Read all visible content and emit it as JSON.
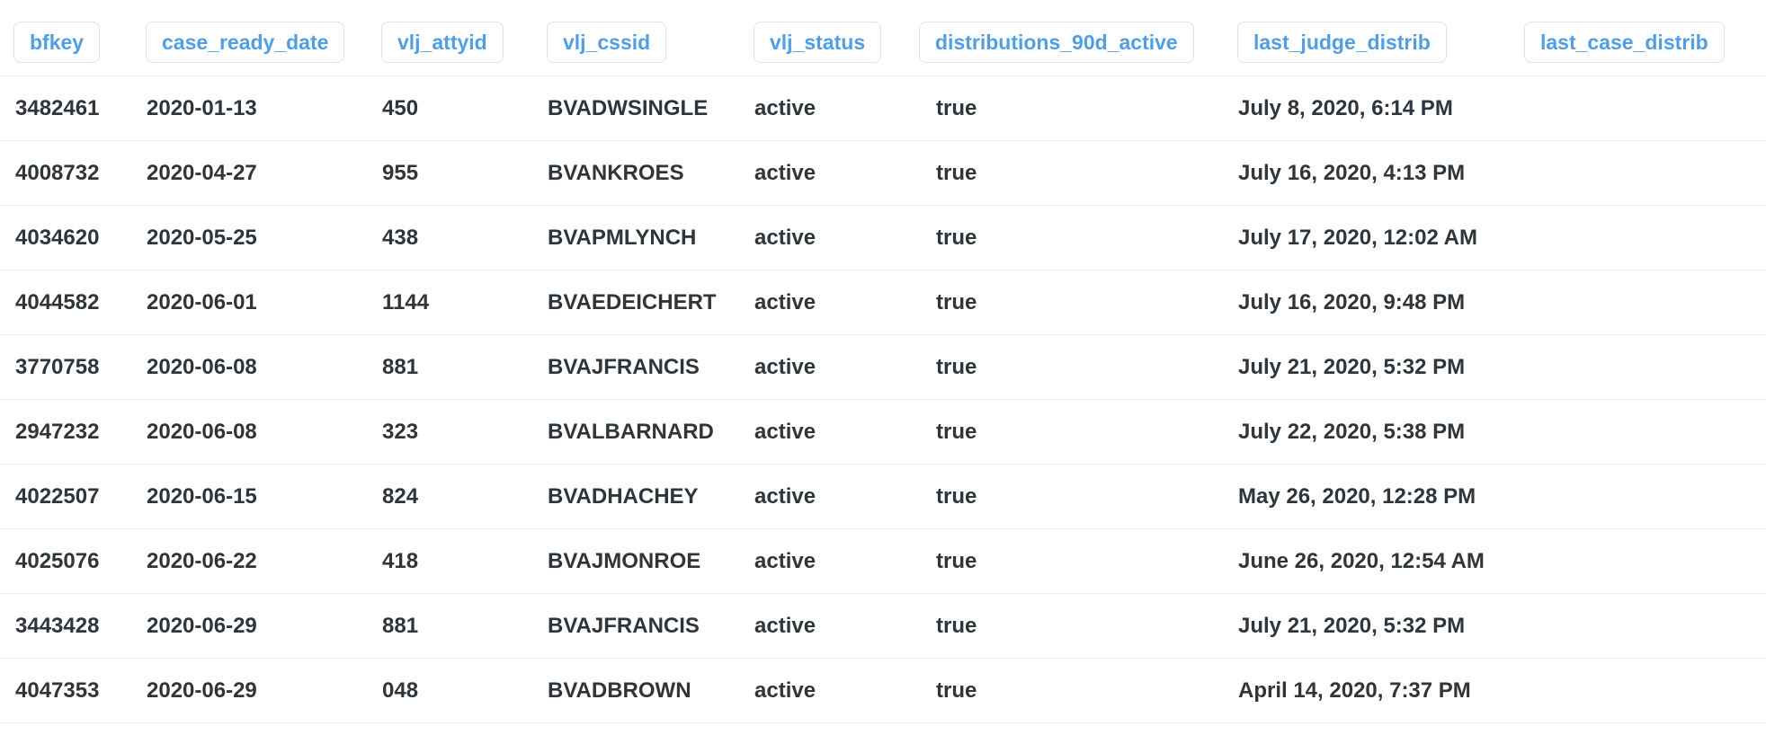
{
  "columns": [
    "bfkey",
    "case_ready_date",
    "vlj_attyid",
    "vlj_cssid",
    "vlj_status",
    "distributions_90d_active",
    "last_judge_distrib",
    "last_case_distrib"
  ],
  "rows": [
    [
      "3482461",
      "2020-01-13",
      "450",
      "BVADWSINGLE",
      "active",
      "true",
      "July 8, 2020, 6:14 PM",
      ""
    ],
    [
      "4008732",
      "2020-04-27",
      "955",
      "BVANKROES",
      "active",
      "true",
      "July 16, 2020, 4:13 PM",
      ""
    ],
    [
      "4034620",
      "2020-05-25",
      "438",
      "BVAPMLYNCH",
      "active",
      "true",
      "July 17, 2020, 12:02 AM",
      ""
    ],
    [
      "4044582",
      "2020-06-01",
      "1144",
      "BVAEDEICHERT",
      "active",
      "true",
      "July 16, 2020, 9:48 PM",
      ""
    ],
    [
      "3770758",
      "2020-06-08",
      "881",
      "BVAJFRANCIS",
      "active",
      "true",
      "July 21, 2020, 5:32 PM",
      ""
    ],
    [
      "2947232",
      "2020-06-08",
      "323",
      "BVALBARNARD",
      "active",
      "true",
      "July 22, 2020, 5:38 PM",
      ""
    ],
    [
      "4022507",
      "2020-06-15",
      "824",
      "BVADHACHEY",
      "active",
      "true",
      "May 26, 2020, 12:28 PM",
      ""
    ],
    [
      "4025076",
      "2020-06-22",
      "418",
      "BVAJMONROE",
      "active",
      "true",
      "June 26, 2020, 12:54 AM",
      ""
    ],
    [
      "3443428",
      "2020-06-29",
      "881",
      "BVAJFRANCIS",
      "active",
      "true",
      "July 21, 2020, 5:32 PM",
      ""
    ],
    [
      "4047353",
      "2020-06-29",
      "048",
      "BVADBROWN",
      "active",
      "true",
      "April 14, 2020, 7:37 PM",
      ""
    ]
  ],
  "colors": {
    "header_text": "#509ee3",
    "header_border": "#d7e6f5",
    "cell_text": "#2e353b",
    "row_divider": "#f0f0f0"
  }
}
